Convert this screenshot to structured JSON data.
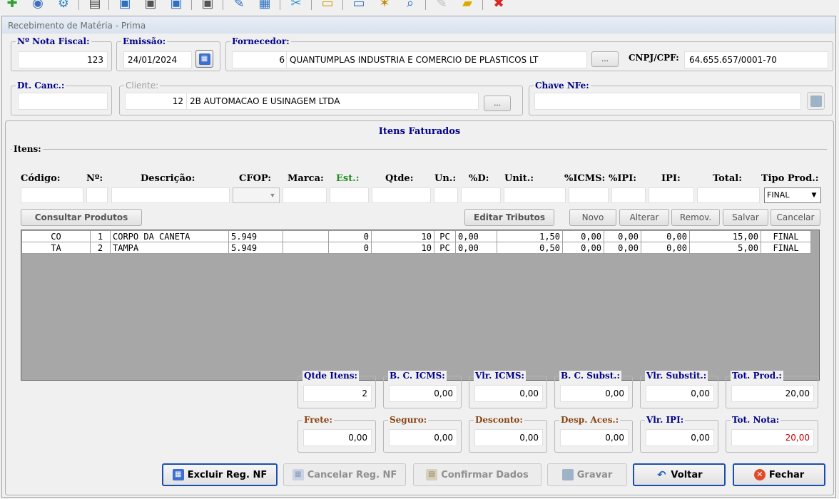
{
  "toolbar": {
    "icons": [
      "add-icon",
      "database-icon",
      "gear-icon",
      "document-icon",
      "window-icon",
      "window-icon",
      "window-icon",
      "window-icon",
      "edit-icon",
      "table-icon",
      "tools-icon",
      "notes-icon",
      "monitor-icon",
      "star-icon",
      "monitor-search-icon",
      "pencil-icon",
      "folder-icon",
      "close-icon"
    ]
  },
  "window": {
    "title": "Recebimento de Matéria - Prima"
  },
  "header": {
    "nota_label": "Nº Nota Fiscal:",
    "nota_value": "123",
    "emissao_label": "Emissão:",
    "emissao_value": "24/01/2024",
    "fornecedor_label": "Fornecedor:",
    "fornecedor_code": "6",
    "fornecedor_name": "QUANTUMPLAS INDUSTRIA E COMERCIO DE PLASTICOS LT",
    "cnpj_label": "CNPJ/CPF:",
    "cnpj_value": "64.655.657/0001-70",
    "dtcanc_label": "Dt. Canc.:",
    "dtcanc_value": "",
    "cliente_label": "Cliente:",
    "cliente_code": "12",
    "cliente_name": "2B AUTOMACAO E USINAGEM LTDA",
    "chave_label": "Chave NFe:",
    "chave_value": "",
    "ellipsis": "..."
  },
  "itens": {
    "section_title": "Itens Faturados",
    "group_label": "Itens:",
    "columns": [
      "Código:",
      "Nº:",
      "Descrição:",
      "CFOP:",
      "Marca:",
      "Est.:",
      "Qtde:",
      "Un.:",
      "%D:",
      "Unit.:",
      "%ICMS:",
      "%IPI:",
      "IPI:",
      "Total:",
      "Tipo Prod.:"
    ],
    "tipo_prod_value": "FINAL",
    "buttons": {
      "consultar": "Consultar Produtos",
      "editar": "Editar Tributos",
      "novo": "Novo",
      "alterar": "Alterar",
      "remover": "Remov.",
      "salvar": "Salvar",
      "cancelar": "Cancelar"
    },
    "rows": [
      [
        "CO",
        "1",
        "CORPO DA CANETA",
        "5.949",
        "",
        "0",
        "10",
        "PC",
        "0,00",
        "1,50",
        "0,00",
        "0,00",
        "0,00",
        "15,00",
        "FINAL"
      ],
      [
        "TA",
        "2",
        "TAMPA",
        "5.949",
        "",
        "0",
        "10",
        "PC",
        "0,00",
        "0,50",
        "0,00",
        "0,00",
        "0,00",
        "5,00",
        "FINAL"
      ]
    ]
  },
  "totals": {
    "qtde_itens_label": "Qtde Itens:",
    "qtde_itens": "2",
    "bc_icms_label": "B. C. ICMS:",
    "bc_icms": "0,00",
    "vlr_icms_label": "Vlr. ICMS:",
    "vlr_icms": "0,00",
    "bc_subst_label": "B. C. Subst.:",
    "bc_subst": "0,00",
    "vlr_subst_label": "Vlr. Substit.:",
    "vlr_subst": "0,00",
    "tot_prod_label": "Tot. Prod.:",
    "tot_prod": "20,00",
    "frete_label": "Frete:",
    "frete": "0,00",
    "seguro_label": "Seguro:",
    "seguro": "0,00",
    "desconto_label": "Desconto:",
    "desconto": "0,00",
    "desp_label": "Desp. Aces.:",
    "desp": "0,00",
    "vlr_ipi_label": "Vlr. IPI:",
    "vlr_ipi": "0,00",
    "tot_nota_label": "Tot. Nota:",
    "tot_nota": "20,00"
  },
  "footer": {
    "excluir": "Excluir Reg. NF",
    "cancelar": "Cancelar Reg. NF",
    "confirmar": "Confirmar Dados",
    "gravar": "Gravar",
    "voltar": "Voltar",
    "fechar": "Fechar"
  },
  "colors": {
    "label_blue": "#00008b",
    "label_brown": "#8b4513",
    "est_green": "#228b22",
    "total_red": "#c00000",
    "grid_bg": "#a7a7a7"
  }
}
